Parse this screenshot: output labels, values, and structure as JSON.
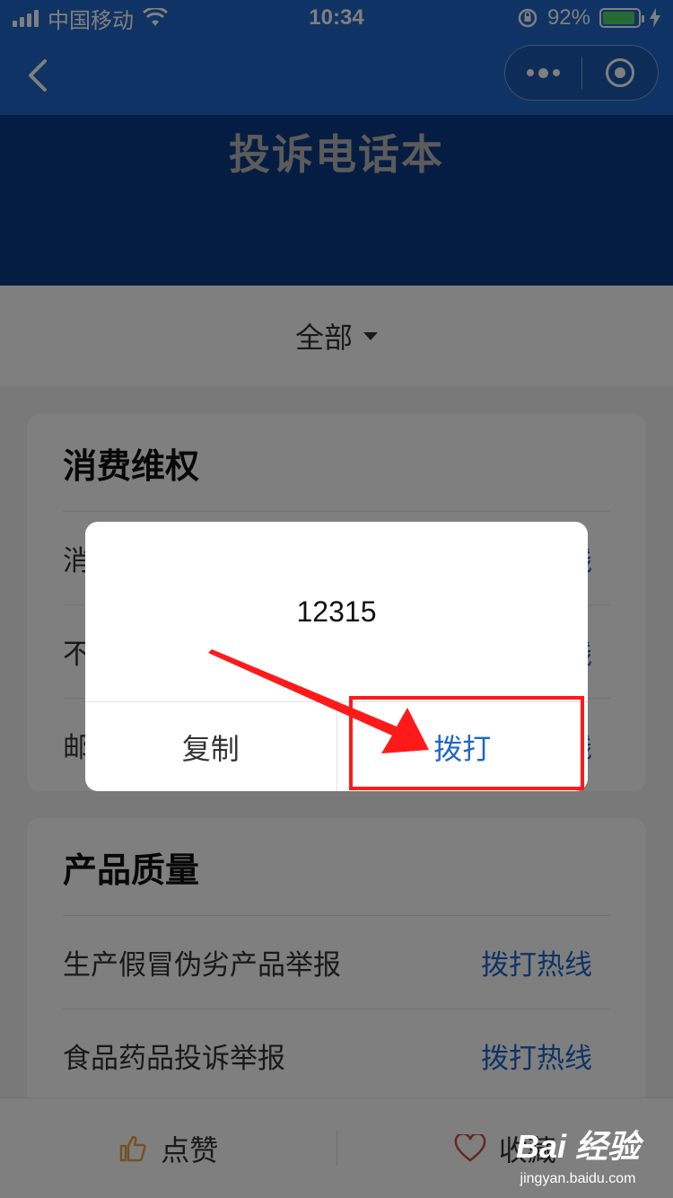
{
  "status_bar": {
    "carrier": "中国移动",
    "time": "10:34",
    "battery": "92%",
    "battery_level": 0.92,
    "battery_color": "#4cd964"
  },
  "nav": {
    "back_icon": "chevron-left-icon",
    "more_icon": "more-dots-icon",
    "close_icon": "target-circle-icon"
  },
  "header": {
    "title": "投诉电话本"
  },
  "filter": {
    "label": "全部"
  },
  "cards": [
    {
      "title": "消费维权",
      "rows": [
        {
          "label": "消",
          "action": "线"
        },
        {
          "label": "不",
          "action": "线"
        },
        {
          "label": "邮",
          "action": "线"
        }
      ]
    },
    {
      "title": "产品质量",
      "rows": [
        {
          "label": "生产假冒伪劣产品举报",
          "action": "拨打热线"
        },
        {
          "label": "食品药品投诉举报",
          "action": "拨打热线"
        }
      ]
    }
  ],
  "bottom_bar": {
    "like_label": "点赞",
    "favorite_label": "收藏",
    "like_icon": "thumbs-up-icon",
    "favorite_icon": "heart-icon"
  },
  "dialog": {
    "content": "12315",
    "copy_label": "复制",
    "call_label": "拨打"
  },
  "watermark": {
    "logo": "Bai 经验",
    "url": "jingyan.baidu.com"
  },
  "colors": {
    "brand_blue": "#1f66c8",
    "banner_navy": "#0d3a86",
    "annotation_red": "#ff1a1a"
  }
}
